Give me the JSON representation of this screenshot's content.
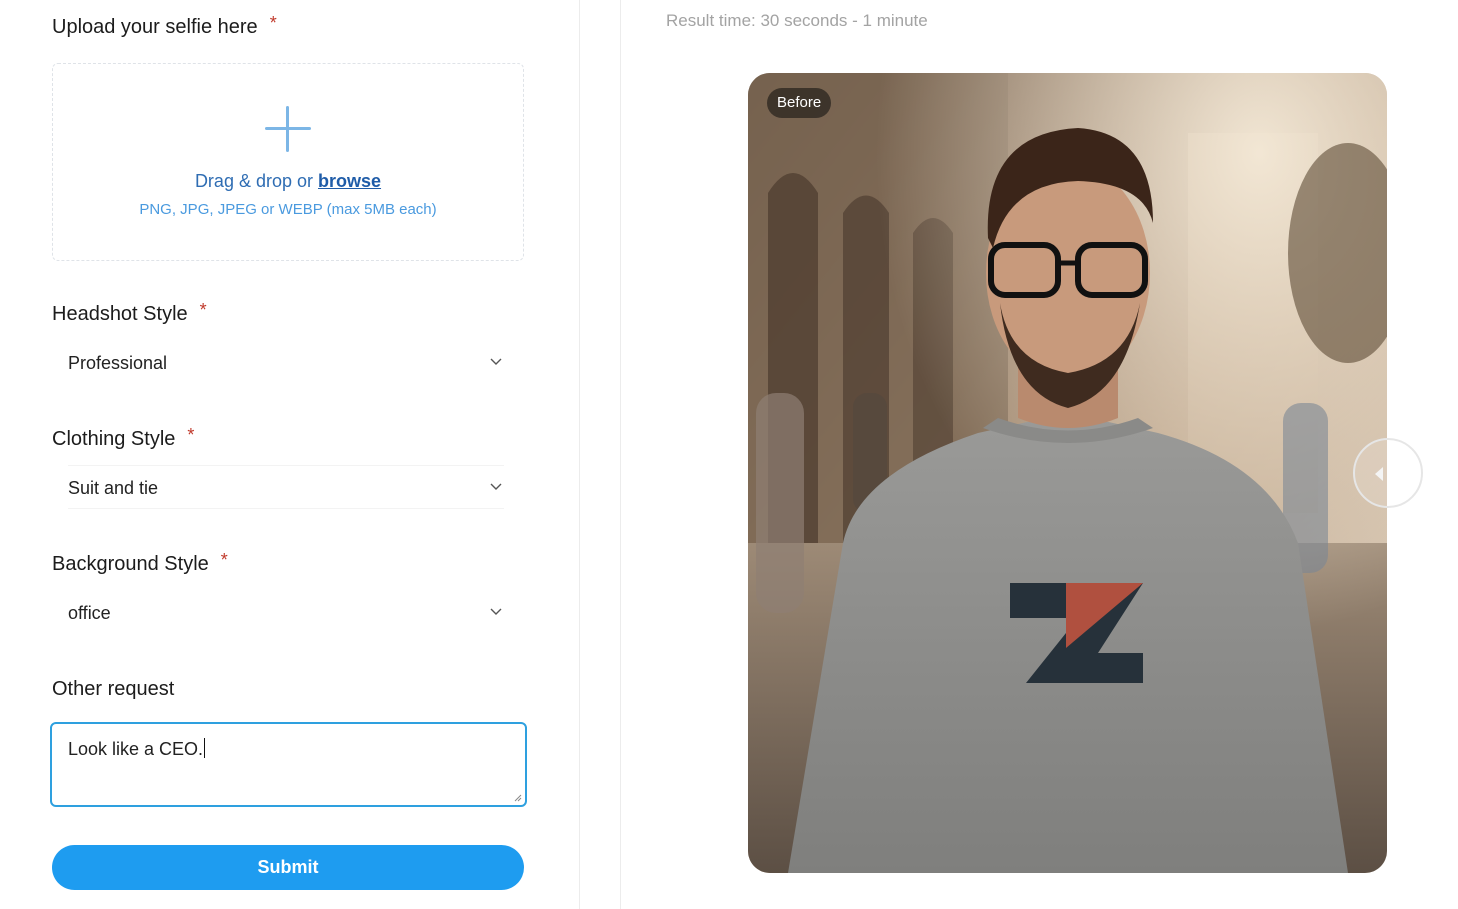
{
  "form": {
    "upload": {
      "label": "Upload your selfie here",
      "required_mark": "*",
      "drop_text": "Drag & drop or",
      "browse_link": "browse",
      "hint": "PNG, JPG, JPEG or WEBP (max 5MB each)",
      "icon": "plus-icon"
    },
    "headshot_style": {
      "label": "Headshot Style",
      "required_mark": "*",
      "value": "Professional"
    },
    "clothing_style": {
      "label": "Clothing Style",
      "required_mark": "*",
      "value": "Suit and tie"
    },
    "background_style": {
      "label": "Background Style",
      "required_mark": "*",
      "value": "office"
    },
    "other_request": {
      "label": "Other request",
      "value": "Look like a CEO."
    },
    "submit_label": "Submit"
  },
  "preview": {
    "result_time": "Result time: 30 seconds - 1 minute",
    "badge": "Before",
    "handle_icon": "chevron-left-icon"
  },
  "colors": {
    "accent": "#1e9cf0",
    "focus_border": "#2ea0df",
    "required": "#c0392b",
    "link": "#1f5ca8"
  }
}
